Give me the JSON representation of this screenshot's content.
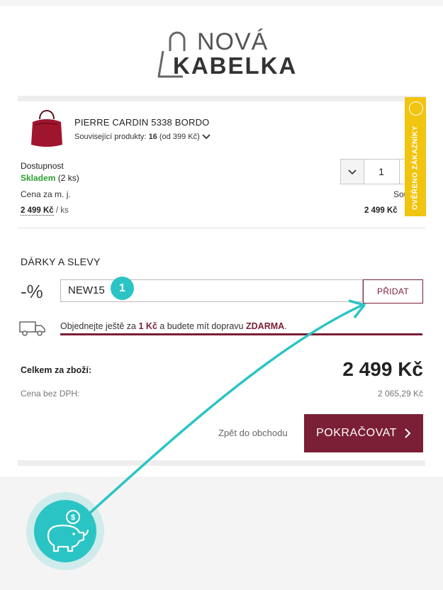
{
  "brand": {
    "line1": "NOVÁ",
    "line2": "KABELKA"
  },
  "product": {
    "name": "PIERRE CARDIN 5338 BORDO",
    "related_label": "Související produkty:",
    "related_count": "16",
    "related_from": "(od 399 Kč)",
    "availability_label": "Dostupnost",
    "stock_status": "Skladem",
    "stock_count": "(2 ks)",
    "unit_price_label": "Cena za m. j.",
    "unit_price": "2 499 Kč",
    "unit_suffix": "/ ks",
    "quantity": "1",
    "sum_label": "Sou",
    "sum_price": "2 499 Kč"
  },
  "badge": {
    "text": "OVĚŘENO ZÁKAZNÍKY"
  },
  "gifts": {
    "title": "DÁRKY A SLEVY",
    "percent_icon": "-%",
    "code_value": "NEW15",
    "add_label": "PŘIDAT",
    "step_marker": "1"
  },
  "shipping": {
    "text_before": "Objednejte ještě za ",
    "amount": "1 Kč",
    "text_middle": " a budete mít dopravu ",
    "free": "ZDARMA",
    "text_end": ".",
    "progress_fraction": 1.0
  },
  "totals": {
    "total_label": "Celkem za zboží:",
    "total_value": "2 499 Kč",
    "net_label": "Cena bez DPH:",
    "net_value": "2 065,29 Kč"
  },
  "actions": {
    "back_label": "Zpět do obchodu",
    "continue_label": "POKRAČOVAT",
    "continue_icon": "chevron-right-icon"
  },
  "colors": {
    "accent": "#7a1f35",
    "teal": "#2bc4c4",
    "badge": "#f1c40f",
    "stock": "#2f9e2f"
  },
  "decor": {
    "piggy_icon": "piggy-bank-icon",
    "truck_icon": "truck-icon"
  }
}
